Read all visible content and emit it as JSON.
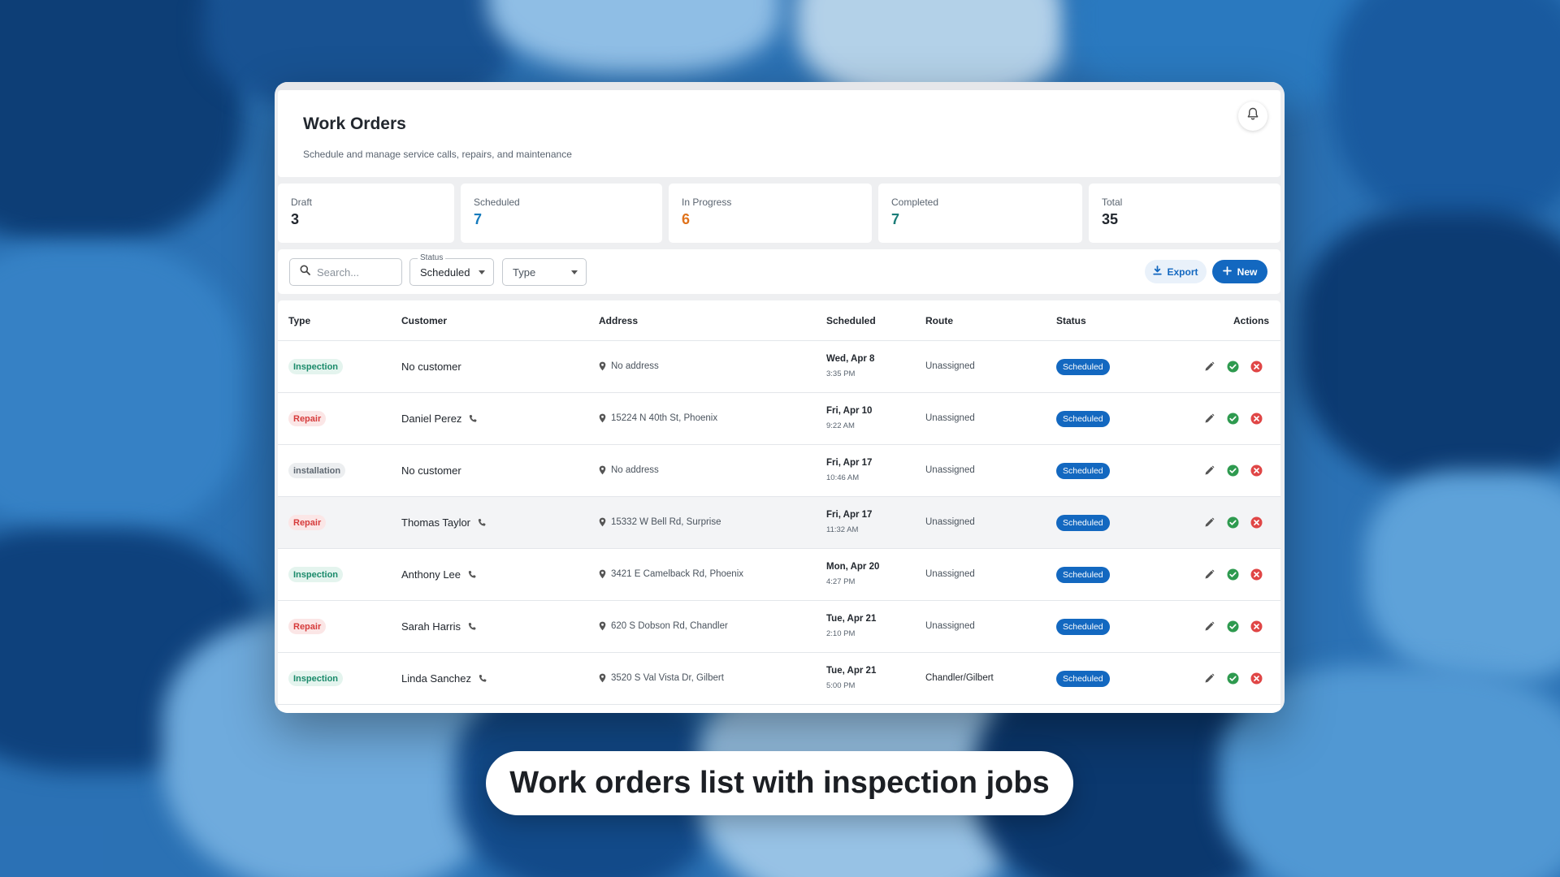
{
  "colors": {
    "accent": "#1368c0",
    "scheduled_value": "#167bbd",
    "in_progress_value": "#e0731c",
    "completed_value": "#1b7d78",
    "inspection": "#1a8a6a",
    "repair": "#d63b3b",
    "installation": "#5f6872",
    "approve": "#2e9a4f",
    "cancel": "#e04646"
  },
  "header": {
    "title": "Work Orders",
    "subtitle": "Schedule and manage service calls, repairs, and maintenance",
    "bell_icon": "bell-icon"
  },
  "stats": [
    {
      "label": "Draft",
      "value": "3"
    },
    {
      "label": "Scheduled",
      "value": "7"
    },
    {
      "label": "In Progress",
      "value": "6"
    },
    {
      "label": "Completed",
      "value": "7"
    },
    {
      "label": "Total",
      "value": "35"
    }
  ],
  "filters": {
    "search_placeholder": "Search...",
    "status_label": "Status",
    "status_value": "Scheduled",
    "type_value": "Type",
    "export_label": "Export",
    "new_label": "New"
  },
  "table": {
    "columns": [
      "Type",
      "Customer",
      "Address",
      "Scheduled",
      "Route",
      "Status",
      "Actions"
    ],
    "rows": [
      {
        "type": "Inspection",
        "customer": "No customer",
        "phone": false,
        "address": "No address",
        "date": "Wed, Apr 8",
        "time": "3:35 PM",
        "route": "Unassigned",
        "status": "Scheduled"
      },
      {
        "type": "Repair",
        "customer": "Daniel Perez",
        "phone": true,
        "address": "15224 N 40th St, Phoenix",
        "date": "Fri, Apr 10",
        "time": "9:22 AM",
        "route": "Unassigned",
        "status": "Scheduled"
      },
      {
        "type": "installation",
        "customer": "No customer",
        "phone": false,
        "address": "No address",
        "date": "Fri, Apr 17",
        "time": "10:46 AM",
        "route": "Unassigned",
        "status": "Scheduled"
      },
      {
        "type": "Repair",
        "customer": "Thomas Taylor",
        "phone": true,
        "address": "15332 W Bell Rd, Surprise",
        "date": "Fri, Apr 17",
        "time": "11:32 AM",
        "route": "Unassigned",
        "status": "Scheduled"
      },
      {
        "type": "Inspection",
        "customer": "Anthony Lee",
        "phone": true,
        "address": "3421 E Camelback Rd, Phoenix",
        "date": "Mon, Apr 20",
        "time": "4:27 PM",
        "route": "Unassigned",
        "status": "Scheduled"
      },
      {
        "type": "Repair",
        "customer": "Sarah Harris",
        "phone": true,
        "address": "620 S Dobson Rd, Chandler",
        "date": "Tue, Apr 21",
        "time": "2:10 PM",
        "route": "Unassigned",
        "status": "Scheduled"
      },
      {
        "type": "Inspection",
        "customer": "Linda Sanchez",
        "phone": true,
        "address": "3520 S Val Vista Dr, Gilbert",
        "date": "Tue, Apr 21",
        "time": "5:00 PM",
        "route": "Chandler/Gilbert",
        "status": "Scheduled"
      }
    ]
  },
  "caption": "Work orders list with inspection jobs"
}
